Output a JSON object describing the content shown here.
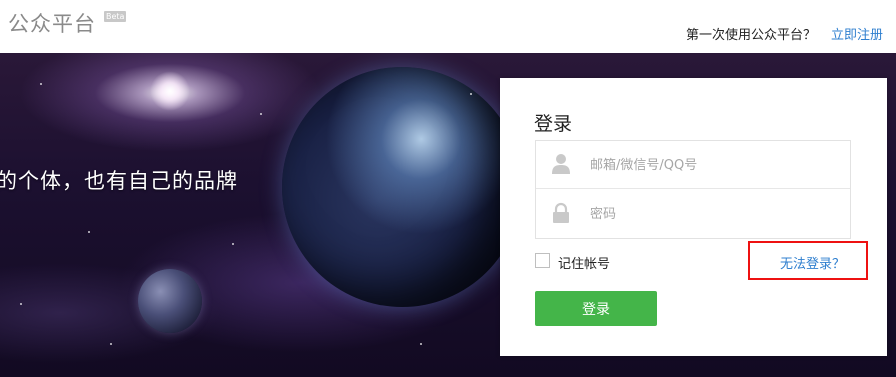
{
  "header": {
    "logo_text": "公众平台",
    "beta_badge": "Beta",
    "first_use_text": "第一次使用公众平台？",
    "register_link": "立即注册"
  },
  "banner": {
    "slogan": "的个体，也有自己的品牌"
  },
  "login": {
    "title": "登录",
    "account_placeholder": "邮箱/微信号/QQ号",
    "account_icon": "user-icon",
    "password_placeholder": "密码",
    "password_icon": "lock-icon",
    "remember_label": "记住帐号",
    "remember_checked": false,
    "forgot_link": "无法登录？",
    "submit_label": "登录"
  },
  "colors": {
    "accent_green": "#44b549",
    "link_blue": "#2f7fcf",
    "highlight_red": "#ee1111"
  }
}
